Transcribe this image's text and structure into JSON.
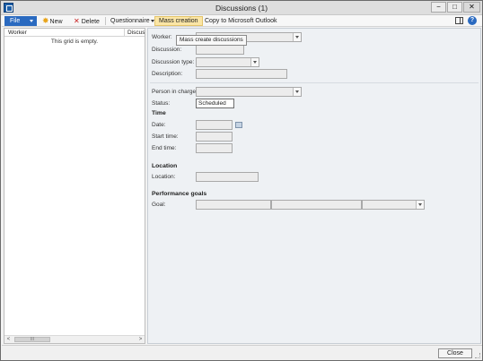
{
  "window": {
    "title": "Discussions (1)",
    "controls": {
      "minimize": "−",
      "maximize": "□",
      "close": "✕"
    }
  },
  "toolbar": {
    "file_label": "File",
    "new_label": "New",
    "delete_label": "Delete",
    "questionnaire_label": "Questionnaire",
    "mass_creation_label": "Mass creation",
    "copy_outlook_label": "Copy to Microsoft Outlook",
    "help_label": "?"
  },
  "tooltip": {
    "text": "Mass create discussions"
  },
  "grid": {
    "columns": [
      "Worker",
      "Discussi"
    ],
    "empty_text": "This grid is empty.",
    "scroll_left": "<",
    "scroll_right": ">",
    "scroll_thumb": "III"
  },
  "form": {
    "worker_label": "Worker:",
    "discussion_label": "Discussion:",
    "discussion_type_label": "Discussion type:",
    "description_label": "Description:",
    "person_in_charge_label": "Person in charge:",
    "status_label": "Status:",
    "status_value": "Scheduled",
    "time_section": "Time",
    "date_label": "Date:",
    "start_time_label": "Start time:",
    "end_time_label": "End time:",
    "location_section": "Location",
    "location_label": "Location:",
    "goals_section": "Performance goals",
    "goal_label": "Goal:"
  },
  "footer": {
    "close_label": "Close"
  },
  "colors": {
    "file_button": "#2a6ac0",
    "mass_creation_highlight": "#fbe6a6",
    "new_icon": "#e8a317",
    "delete_icon": "#c81f1f"
  }
}
